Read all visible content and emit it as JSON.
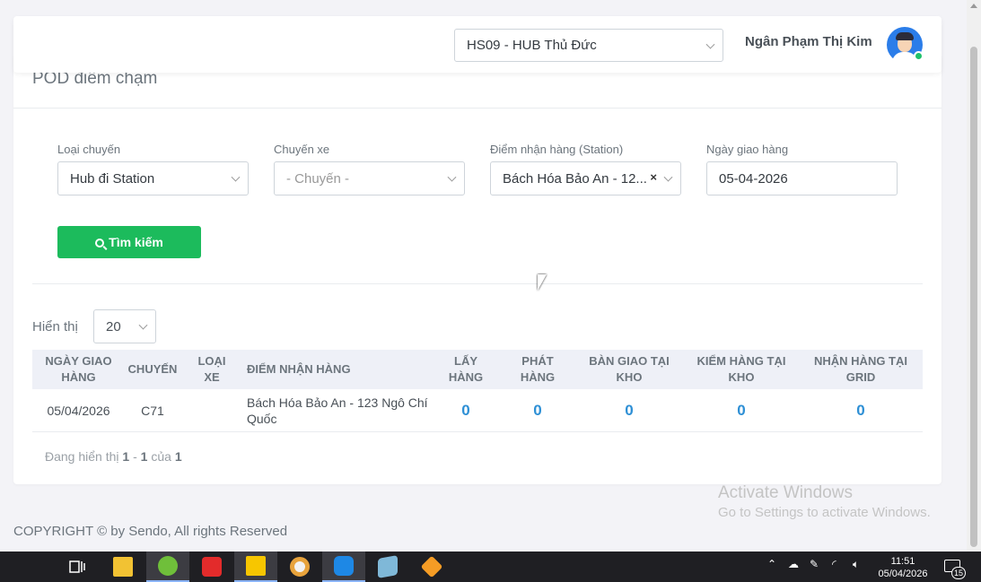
{
  "header": {
    "hub_select": "HS09 - HUB Thủ Đức",
    "user_name": "Ngân Phạm Thị Kim"
  },
  "page": {
    "title": "POD điểm chạm"
  },
  "filters": {
    "trip_type": {
      "label": "Loại chuyến",
      "value": "Hub đi Station"
    },
    "trip": {
      "label": "Chuyến xe",
      "placeholder": "- Chuyến -"
    },
    "station": {
      "label": "Điểm nhận hàng (Station)",
      "value": "Bách Hóa Bảo An - 12...",
      "clear": "×"
    },
    "delivery_date": {
      "label": "Ngày giao hàng",
      "value": "05-04-2026"
    },
    "search_label": "Tìm kiếm"
  },
  "pagination": {
    "show_label": "Hiển thị",
    "page_size": "20",
    "info_prefix": "Đang hiển thị",
    "from": "1",
    "dash": "-",
    "to": "1",
    "of_label": "của",
    "total": "1"
  },
  "table": {
    "columns": [
      "Ngày giao hàng",
      "Chuyến",
      "Loại xe",
      "Điểm nhận hàng",
      "Lấy hàng",
      "Phát hàng",
      "Bàn giao tại kho",
      "Kiểm hàng tại kho",
      "Nhận hàng tại Grid"
    ],
    "rows": [
      {
        "date": "05/04/2026",
        "trip": "C71",
        "vehicle": "",
        "point": "Bách Hóa Bảo An - 123 Ngô Chí Quốc",
        "pickup": "0",
        "delivery": "0",
        "handover": "0",
        "check": "0",
        "grid": "0"
      }
    ]
  },
  "footer": {
    "copyright": "COPYRIGHT © by Sendo, All rights Reserved"
  },
  "watermark": {
    "title": "Activate Windows",
    "subtitle": "Go to Settings to activate Windows."
  },
  "taskbar": {
    "time": "11:51",
    "date": "05/04/2026",
    "notification_count": "15",
    "colors": {
      "files": "#f2c233",
      "wps": "#e32b2b",
      "notes": "#f7c600",
      "chrome": "#f2f2f2",
      "zalo": "#1e88e5",
      "app": "#7fb8d8",
      "sublime": "#f59c25"
    }
  }
}
